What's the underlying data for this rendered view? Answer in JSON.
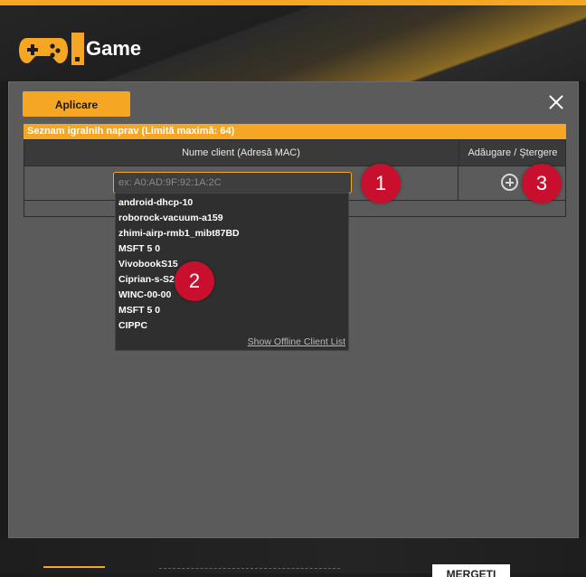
{
  "app": {
    "title": "Game"
  },
  "icons": {
    "logo": "gamepad-icon",
    "close": "close-icon",
    "add": "plus-circle-icon"
  },
  "colors": {
    "accent": "#f5a623",
    "marker": "#c8102e"
  },
  "toolbar": {
    "apply_label": "Aplicare"
  },
  "table": {
    "title": "Seznam igralnih naprav (Limită maximă: 64)",
    "columns": [
      "Nume client (Adresă MAC)",
      "Adăugare / Ştergere"
    ],
    "mac_placeholder": "ex: A0:AD:9F:92:1A:2C",
    "mac_value": ""
  },
  "dropdown": {
    "items": [
      "android-dhcp-10",
      "roborock-vacuum-a159",
      "zhimi-airp-rmb1_mibt87BD",
      "MSFT 5 0",
      "VivobookS15",
      "Ciprian-s-S23",
      "WINC-00-00",
      "MSFT 5 0",
      "CIPPC"
    ],
    "footer_link": "Show Offline Client List"
  },
  "markers": [
    "1",
    "2",
    "3"
  ],
  "background": {
    "bottom_button": "MERGETI"
  }
}
